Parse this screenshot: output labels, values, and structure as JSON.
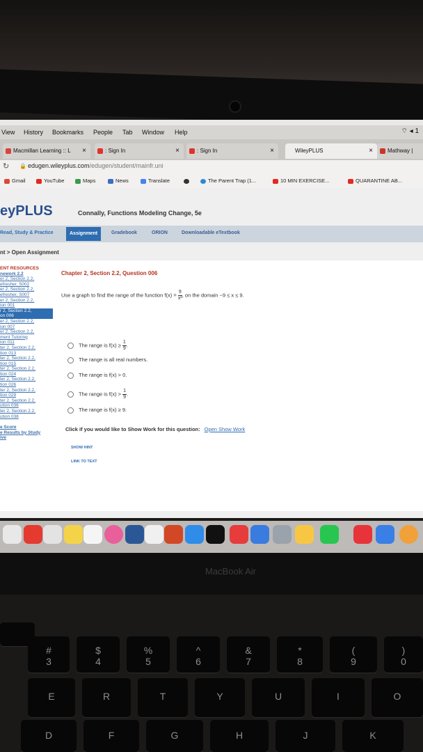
{
  "mac_menu": {
    "items": [
      "View",
      "History",
      "Bookmarks",
      "People",
      "Tab",
      "Window",
      "Help"
    ],
    "right": "1"
  },
  "tabs": [
    {
      "label": "Macmillan Learning :: L"
    },
    {
      "label": ": Sign In"
    },
    {
      "label": ": Sign In"
    },
    {
      "label": "WileyPLUS"
    },
    {
      "label": "Mathway |"
    }
  ],
  "address": {
    "domain": "edugen.wileyplus.com",
    "path": "/edugen/student/mainfr.uni"
  },
  "bookmarks": [
    "Gmail",
    "YouTube",
    "Maps",
    "News",
    "Translate",
    "The Parent Trap (1...",
    "10 MIN EXERCISE...",
    "QUARANTINE AB..."
  ],
  "header": {
    "brand": "eyPLUS",
    "book": "Connally, Functions Modeling Change, 5e"
  },
  "nav": [
    "Read, Study & Practice",
    "Assignment",
    "Gradebook",
    "ORION",
    "Downloadable eTextbook"
  ],
  "breadcrumb": "nt > Open Assignment",
  "sidebar": {
    "header": "ENT RESOURCES",
    "items": [
      "nework 2.2",
      "er 2, Section 2.2,",
      "efresher, S002",
      "er 2, Section 2.2,",
      "efresher, S007",
      "er 2, Section 2.2,",
      "ion 001",
      "r 2, Section 2.2,",
      "on 006",
      "er 2, Section 2.2,",
      "ion 007",
      "er 2, Section 2.2,",
      "ment Tutoring",
      "ion 011",
      "ter 2, Section 2.2,",
      "tion 013",
      "ter 2, Section 2.2,",
      "tion 015",
      "ter 2, Section 2.2,",
      "tion 024",
      "ter 2, Section 2.2,",
      "tion 026",
      "ter 2, Section 2.2,",
      "tion 029",
      "ter 2, Section 2.2,",
      "ution 036",
      "ter 2, Section 2.2,",
      "ution 038"
    ],
    "footer": [
      "e Score",
      "e Results by Study",
      "ive"
    ]
  },
  "question": {
    "title": "Chapter 2, Section 2.2, Question 006",
    "prompt_a": "Use a graph to find the range of the function f(x) =",
    "fn_num": "9",
    "fn_den": "x²",
    "prompt_b": ", on the domain −9 ≤ x ≤ 9.",
    "options": [
      {
        "text": "The range is f(x) ≥",
        "num": "1",
        "den": "9",
        "end": "."
      },
      {
        "text": "The range is all real numbers.",
        "num": "",
        "den": "",
        "end": ""
      },
      {
        "text": "The range is f(x) > 0.",
        "num": "",
        "den": "",
        "end": ""
      },
      {
        "text": "The range is f(x) >",
        "num": "1",
        "den": "9",
        "end": "."
      },
      {
        "text": "The range is f(x) ≥ 9.",
        "num": "",
        "den": "",
        "end": ""
      }
    ],
    "showwork_label": "Click if you would like to Show Work for this question:",
    "showwork_link": "Open Show Work",
    "hint": "SHOW HINT",
    "link_to_text": "LINK TO TEXT"
  },
  "laptop_label": "MacBook Air",
  "keys_num": [
    "#\n3",
    "$\n4",
    "%\n5",
    "^\n6",
    "&\n7",
    "*\n8",
    "(\n9",
    ")\n0"
  ],
  "keys_top": [
    "E",
    "R",
    "T",
    "Y",
    "U",
    "I",
    "O"
  ],
  "keys_mid": [
    "D",
    "F",
    "G",
    "H",
    "J",
    "K"
  ]
}
